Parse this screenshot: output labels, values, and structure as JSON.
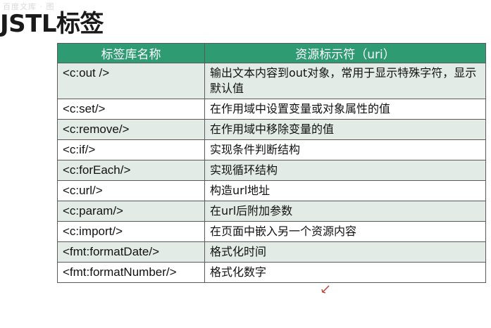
{
  "watermark": "百度文库 · 图",
  "title": "JSTL标签",
  "table": {
    "headers": [
      "标签库名称",
      "资源标示符（uri）"
    ],
    "rows": [
      {
        "tag": "<c:out />",
        "desc": "输出文本内容到out对象，常用于显示特殊字符，显示默认值"
      },
      {
        "tag": "<c:set/>",
        "desc": "在作用域中设置变量或对象属性的值"
      },
      {
        "tag": "<c:remove/>",
        "desc": "在作用域中移除变量的值"
      },
      {
        "tag": "<c:if/>",
        "desc": "实现条件判断结构"
      },
      {
        "tag": "<c:forEach/>",
        "desc": "实现循环结构"
      },
      {
        "tag": "<c:url/>",
        "desc": "构造url地址"
      },
      {
        "tag": "<c:param/>",
        "desc": "在url后附加参数"
      },
      {
        "tag": "<c:import/>",
        "desc": "在页面中嵌入另一个资源内容"
      },
      {
        "tag": "<fmt:formatDate/>",
        "desc": "格式化时间"
      },
      {
        "tag": "<fmt:formatNumber/>",
        "desc": "格式化数字"
      }
    ]
  },
  "colors": {
    "header_bg": "#2e9b72",
    "row_alt_bg": "#e2ebe6",
    "cursor": "#c0392b"
  },
  "cursor_icon": "pen-cursor-icon"
}
